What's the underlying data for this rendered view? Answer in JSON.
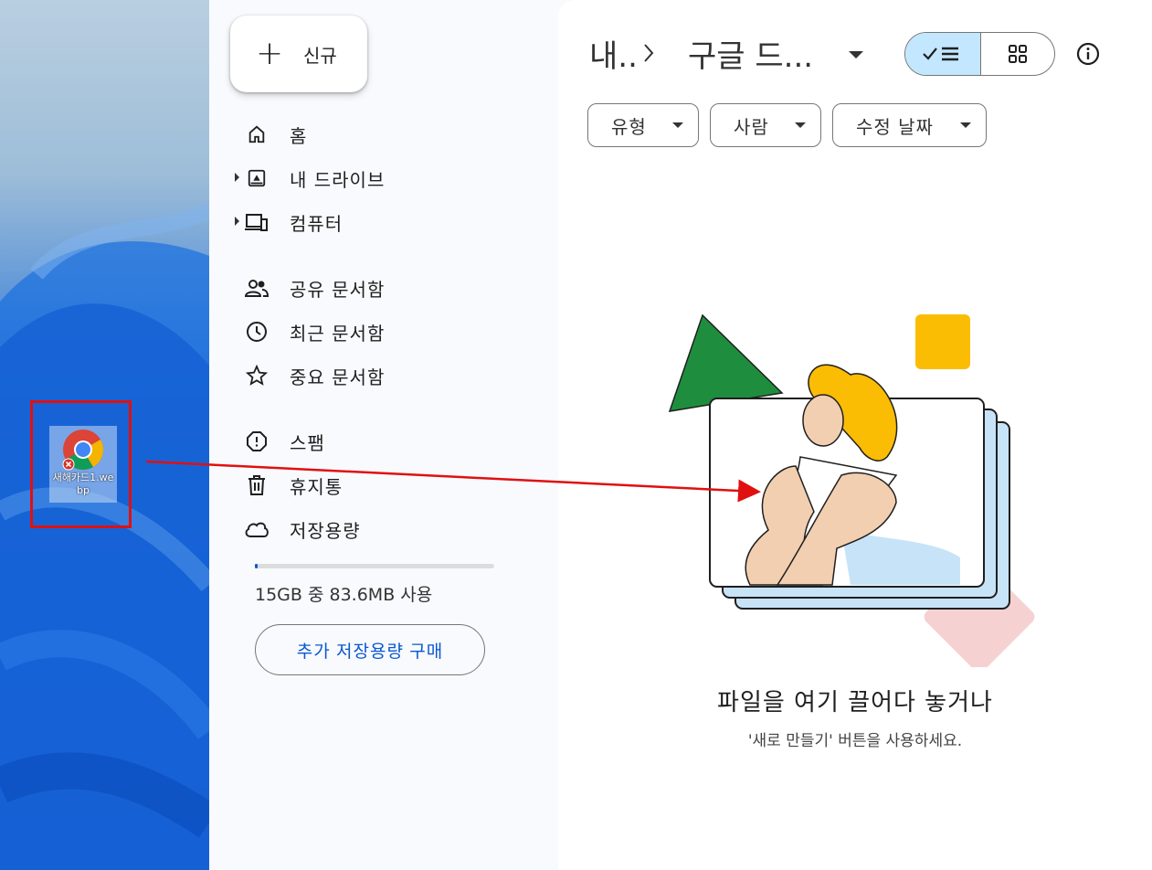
{
  "desktop": {
    "file_label": "새해카드1.webp"
  },
  "sidebar": {
    "new_label": "신규",
    "items": [
      {
        "label": "홈"
      },
      {
        "label": "내 드라이브"
      },
      {
        "label": "컴퓨터"
      },
      {
        "label": "공유 문서함"
      },
      {
        "label": "최근 문서함"
      },
      {
        "label": "중요 문서함"
      },
      {
        "label": "스팸"
      },
      {
        "label": "휴지통"
      },
      {
        "label": "저장용량"
      }
    ],
    "storage_text": "15GB 중 83.6MB 사용",
    "storage_used_fraction": 0.0056,
    "buy_label": "추가 저장용량 구매"
  },
  "header": {
    "crumb_parent": "내..",
    "crumb_current": "구글 드...",
    "view_mode": "list"
  },
  "filters": [
    {
      "label": "유형"
    },
    {
      "label": "사람"
    },
    {
      "label": "수정 날짜"
    }
  ],
  "empty_state": {
    "title": "파일을 여기 끌어다 놓거나",
    "subtitle": "'새로 만들기' 버튼을 사용하세요."
  },
  "colors": {
    "accent_blue": "#0b57d0",
    "selected_view": "#c2e7ff",
    "annotation_red": "#e01010"
  }
}
